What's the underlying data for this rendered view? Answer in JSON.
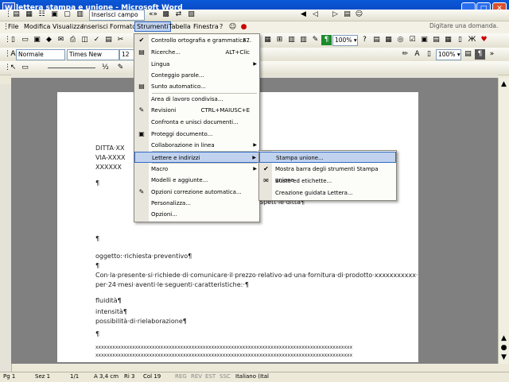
{
  "window": {
    "title": "lettera stampa e unione - Microsoft Word"
  },
  "wordbar": {
    "insert_field": "Inserisci campo Word"
  },
  "menubar": {
    "items": [
      "File",
      "Modifica",
      "Visualizza",
      "Inserisci",
      "Formato",
      "Strumenti",
      "Tabella",
      "Finestra",
      "?"
    ],
    "help_placeholder": "Digitare una domanda."
  },
  "toolbar": {
    "zoom": "100%",
    "style": "Normale",
    "font": "Times New Roman",
    "size": "12",
    "zoom2": "100%"
  },
  "menu": {
    "items": [
      {
        "label": "Controllo ortografia e grammatica...",
        "shortcut": "F7"
      },
      {
        "label": "Ricerche...",
        "shortcut": "ALT+Clic"
      },
      {
        "label": "Lingua"
      },
      {
        "label": "Conteggio parole..."
      },
      {
        "label": "Sunto automatico..."
      },
      {
        "label": "Area di lavoro condivisa..."
      },
      {
        "label": "Revisioni",
        "shortcut": "CTRL+MAIUSC+E"
      },
      {
        "label": "Confronta e unisci documenti..."
      },
      {
        "label": "Proteggi documento..."
      },
      {
        "label": "Collaborazione in linea"
      },
      {
        "label": "Lettere e indirizzi"
      },
      {
        "label": "Macro"
      },
      {
        "label": "Modelli e aggiunte..."
      },
      {
        "label": "Opzioni correzione automatica..."
      },
      {
        "label": "Personalizza..."
      },
      {
        "label": "Opzioni..."
      }
    ]
  },
  "submenu": {
    "items": [
      {
        "label": "Stampa unione..."
      },
      {
        "label": "Mostra barra degli strumenti Stampa unione"
      },
      {
        "label": "Buste ed etichette..."
      },
      {
        "label": "Creazione guidata Lettera..."
      }
    ]
  },
  "document": {
    "lines": {
      "l1": "DITTA·XX",
      "l2": "VIA-XXXX",
      "l3": "XXXXXX",
      "pilcrow": "¶",
      "spett": "Spett·le·ditta¶",
      "oggetto": "oggetto:·richiesta·preventivo¶",
      "body1": "Con·la·presente·si·richiede·di·comunicare·il·prezzo·relativo·ad·una·fornitura·di·prodotto·xxxxxxxxxxx·",
      "body2": "per·24·mesi·aventi·le·seguenti·caratteristiche:·¶",
      "f1": "fluidità¶",
      "f2": "intensità¶",
      "f3": "possibilità·di·rielaborazione¶",
      "xline": "xxxxxxxxxxxxxxxxxxxxxxxxxxxxxxxxxxxxxxxxxxxxxxxxxxxxxxxxxxxxxxxxxxxxxxxxxxxxxxxxxxxxxxxxxxx"
    }
  },
  "statusbar": {
    "page": "Pg 1",
    "section": "Sez 1",
    "pages": "1/1",
    "position": "A 3,4 cm",
    "line": "Ri 3",
    "col": "Col 19",
    "rec": "REG",
    "rev": "REV",
    "ext": "EST",
    "ssc": "SSC",
    "lang": "Italiano (Ital"
  },
  "colors": {
    "title_bar": "#0a58d8",
    "highlight": "#c1d2ee",
    "highlight_border": "#316ac5"
  }
}
